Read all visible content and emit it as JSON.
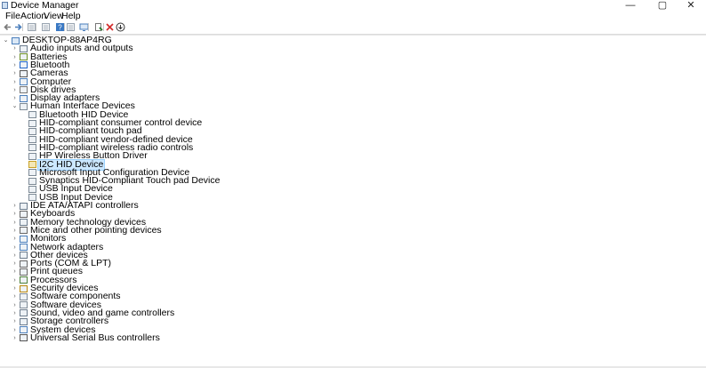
{
  "window": {
    "title": "Device Manager",
    "controls": {
      "minimize": "—",
      "maximize": "▢",
      "close": "✕"
    }
  },
  "menu": [
    "File",
    "Action",
    "View",
    "Help"
  ],
  "toolbar": [
    {
      "name": "back-arrow-icon",
      "color": "#7a7a7a"
    },
    {
      "name": "forward-arrow-icon",
      "color": "#4a7ebb"
    },
    {
      "name": "properties-grid-icon",
      "color": "#9aa5b1"
    },
    {
      "name": "show-hide-tree-icon",
      "color": "#9aa5b1"
    },
    {
      "name": "help-icon",
      "color": "#3a78c3"
    },
    {
      "name": "view-panel-icon",
      "color": "#9aa5b1"
    },
    {
      "name": "scan-monitor-icon",
      "color": "#4a7ebb"
    },
    {
      "name": "update-driver-icon",
      "color": "#2f7d32"
    },
    {
      "name": "uninstall-x-icon",
      "color": "#d32f2f"
    },
    {
      "name": "download-circle-icon",
      "color": "#333333"
    }
  ],
  "tree": {
    "root": "DESKTOP-88AP4RG",
    "selected": "I2C HID Device",
    "items": [
      {
        "label": "Audio inputs and outputs",
        "icon": "speaker-icon",
        "color": "#6b7b8c",
        "level": 1,
        "expanded": false
      },
      {
        "label": "Batteries",
        "icon": "battery-icon",
        "color": "#6b8e23",
        "level": 1,
        "expanded": false
      },
      {
        "label": "Bluetooth",
        "icon": "bluetooth-icon",
        "color": "#1e63c8",
        "level": 1,
        "expanded": false
      },
      {
        "label": "Cameras",
        "icon": "camera-icon",
        "color": "#555555",
        "level": 1,
        "expanded": false
      },
      {
        "label": "Computer",
        "icon": "computer-icon",
        "color": "#4a7ebb",
        "level": 1,
        "expanded": false
      },
      {
        "label": "Disk drives",
        "icon": "disk-drive-icon",
        "color": "#777777",
        "level": 1,
        "expanded": false
      },
      {
        "label": "Display adapters",
        "icon": "display-adapter-icon",
        "color": "#4a7ebb",
        "level": 1,
        "expanded": false
      },
      {
        "label": "Human Interface Devices",
        "icon": "hid-icon",
        "color": "#7d8a96",
        "level": 1,
        "expanded": true
      },
      {
        "label": "Bluetooth HID Device",
        "icon": "hid-device-icon",
        "color": "#7d8a96",
        "level": 2
      },
      {
        "label": "HID-compliant consumer control device",
        "icon": "hid-device-icon",
        "color": "#7d8a96",
        "level": 2
      },
      {
        "label": "HID-compliant touch pad",
        "icon": "hid-device-icon",
        "color": "#7d8a96",
        "level": 2
      },
      {
        "label": "HID-compliant vendor-defined device",
        "icon": "hid-device-icon",
        "color": "#7d8a96",
        "level": 2
      },
      {
        "label": "HID-compliant wireless radio controls",
        "icon": "hid-device-icon",
        "color": "#7d8a96",
        "level": 2
      },
      {
        "label": "HP Wireless Button Driver",
        "icon": "hid-device-icon",
        "color": "#7d8a96",
        "level": 2
      },
      {
        "label": "I2C HID Device",
        "icon": "hid-warning-icon",
        "color": "#c9a227",
        "level": 2
      },
      {
        "label": "Microsoft Input Configuration Device",
        "icon": "hid-device-icon",
        "color": "#7d8a96",
        "level": 2
      },
      {
        "label": "Synaptics HID-Compliant Touch pad Device",
        "icon": "hid-device-icon",
        "color": "#7d8a96",
        "level": 2
      },
      {
        "label": "USB Input Device",
        "icon": "hid-device-icon",
        "color": "#7d8a96",
        "level": 2
      },
      {
        "label": "USB Input Device",
        "icon": "hid-device-icon",
        "color": "#7d8a96",
        "level": 2
      },
      {
        "label": "IDE ATA/ATAPI controllers",
        "icon": "ide-controller-icon",
        "color": "#6b7b8c",
        "level": 1,
        "expanded": false
      },
      {
        "label": "Keyboards",
        "icon": "keyboard-icon",
        "color": "#666666",
        "level": 1,
        "expanded": false
      },
      {
        "label": "Memory technology devices",
        "icon": "memory-icon",
        "color": "#6b7b8c",
        "level": 1,
        "expanded": false
      },
      {
        "label": "Mice and other pointing devices",
        "icon": "mouse-icon",
        "color": "#666666",
        "level": 1,
        "expanded": false
      },
      {
        "label": "Monitors",
        "icon": "monitor-icon",
        "color": "#4a7ebb",
        "level": 1,
        "expanded": false
      },
      {
        "label": "Network adapters",
        "icon": "network-adapter-icon",
        "color": "#4a7ebb",
        "level": 1,
        "expanded": false
      },
      {
        "label": "Other devices",
        "icon": "other-devices-icon",
        "color": "#6b7b8c",
        "level": 1,
        "expanded": false
      },
      {
        "label": "Ports (COM & LPT)",
        "icon": "port-icon",
        "color": "#666666",
        "level": 1,
        "expanded": false
      },
      {
        "label": "Print queues",
        "icon": "printer-icon",
        "color": "#666666",
        "level": 1,
        "expanded": false
      },
      {
        "label": "Processors",
        "icon": "processor-icon",
        "color": "#4b7f3a",
        "level": 1,
        "expanded": false
      },
      {
        "label": "Security devices",
        "icon": "security-device-icon",
        "color": "#b8860b",
        "level": 1,
        "expanded": false
      },
      {
        "label": "Software components",
        "icon": "software-component-icon",
        "color": "#7d8a96",
        "level": 1,
        "expanded": false
      },
      {
        "label": "Software devices",
        "icon": "software-device-icon",
        "color": "#7d8a96",
        "level": 1,
        "expanded": false
      },
      {
        "label": "Sound, video and game controllers",
        "icon": "sound-icon",
        "color": "#6b7b8c",
        "level": 1,
        "expanded": false
      },
      {
        "label": "Storage controllers",
        "icon": "storage-controller-icon",
        "color": "#6b7b8c",
        "level": 1,
        "expanded": false
      },
      {
        "label": "System devices",
        "icon": "system-device-icon",
        "color": "#4a7ebb",
        "level": 1,
        "expanded": false
      },
      {
        "label": "Universal Serial Bus controllers",
        "icon": "usb-icon",
        "color": "#555555",
        "level": 1,
        "expanded": false
      }
    ]
  }
}
